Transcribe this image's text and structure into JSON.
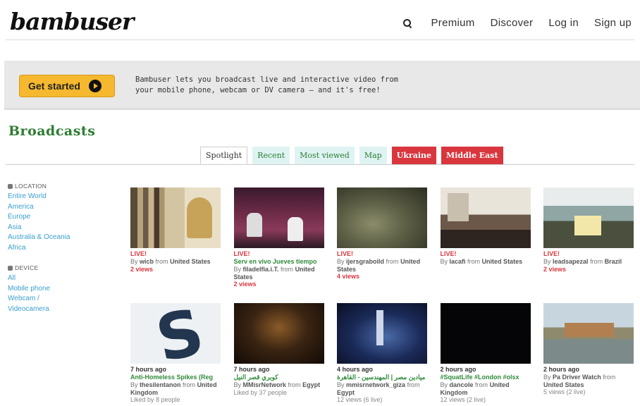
{
  "header": {
    "logo": "bambuser",
    "nav": [
      "Premium",
      "Discover",
      "Log in",
      "Sign up"
    ]
  },
  "promo": {
    "button": "Get started",
    "text": "Bambuser lets you broadcast live and interactive video from your mobile phone, webcam or DV camera — and it's free!"
  },
  "broadcasts": {
    "title": "Broadcasts",
    "tabs": [
      "Spotlight",
      "Recent",
      "Most viewed",
      "Map",
      "Ukraine",
      "Middle East"
    ],
    "active_tab": "Spotlight"
  },
  "sidebar": {
    "location_heading": "LOCATION",
    "locations": [
      "Entire World",
      "America",
      "Europe",
      "Asia",
      "Australia & Oceania",
      "Africa"
    ],
    "device_heading": "DEVICE",
    "devices": [
      "All",
      "Mobile phone",
      "Webcam / Videocamera"
    ]
  },
  "cards": [
    {
      "status": "LIVE!",
      "title": "",
      "by_user": "wicb",
      "from_prefix": "from",
      "from_place": "United States",
      "views": "2 views"
    },
    {
      "status": "LIVE!",
      "title": "Serv en vivo Jueves tiempo",
      "by_user": "filadelfia.i.T.",
      "from_prefix": "from",
      "from_place": "United States",
      "views": "2 views"
    },
    {
      "status": "LIVE!",
      "title": "",
      "by_user": "ijersgraboild",
      "from_prefix": "from",
      "from_place": "United States",
      "views": "4 views"
    },
    {
      "status": "LIVE!",
      "title": "",
      "by_user": "lacafi",
      "from_prefix": "from",
      "from_place": "United States",
      "views": ""
    },
    {
      "status": "LIVE!",
      "title": "",
      "by_user": "leadsapezal",
      "from_prefix": "from",
      "from_place": "Brazil",
      "views": "2 views"
    },
    {
      "status": "7 hours ago",
      "title": "Anti-Homeless Spikes (Reg",
      "by_user": "thesilentanon",
      "from_prefix": "from",
      "from_place": "United Kingdom",
      "views": "Liked by 8 people"
    },
    {
      "status": "7 hours ago",
      "title": "كوبري قصر النيل",
      "by_user": "MMisrNetwork",
      "from_prefix": "from",
      "from_place": "Egypt",
      "views": "Liked by 37 people"
    },
    {
      "status": "4 hours ago",
      "title": "ميادين مصر | المهندسين - القاهرة",
      "by_user": "mmisrnetwork_giza",
      "from_prefix": "from",
      "from_place": "Egypt",
      "views": "12 views (6 live)"
    },
    {
      "status": "2 hours ago",
      "title": "#SquatLife #London #olsx",
      "by_user": "dancole",
      "from_prefix": "from",
      "from_place": "United Kingdom",
      "views": "12 views (2 live)"
    },
    {
      "status": "2 hours ago",
      "title": "",
      "by_user": "Pa Driver Watch",
      "from_prefix": "from",
      "from_place": "United States",
      "views": "5 views (2 live)"
    }
  ],
  "colors": {
    "brand_green": "#2e7d32",
    "live_red": "#d9363e",
    "link_blue": "#3a9fcf",
    "button_yellow": "#f5b82e"
  }
}
